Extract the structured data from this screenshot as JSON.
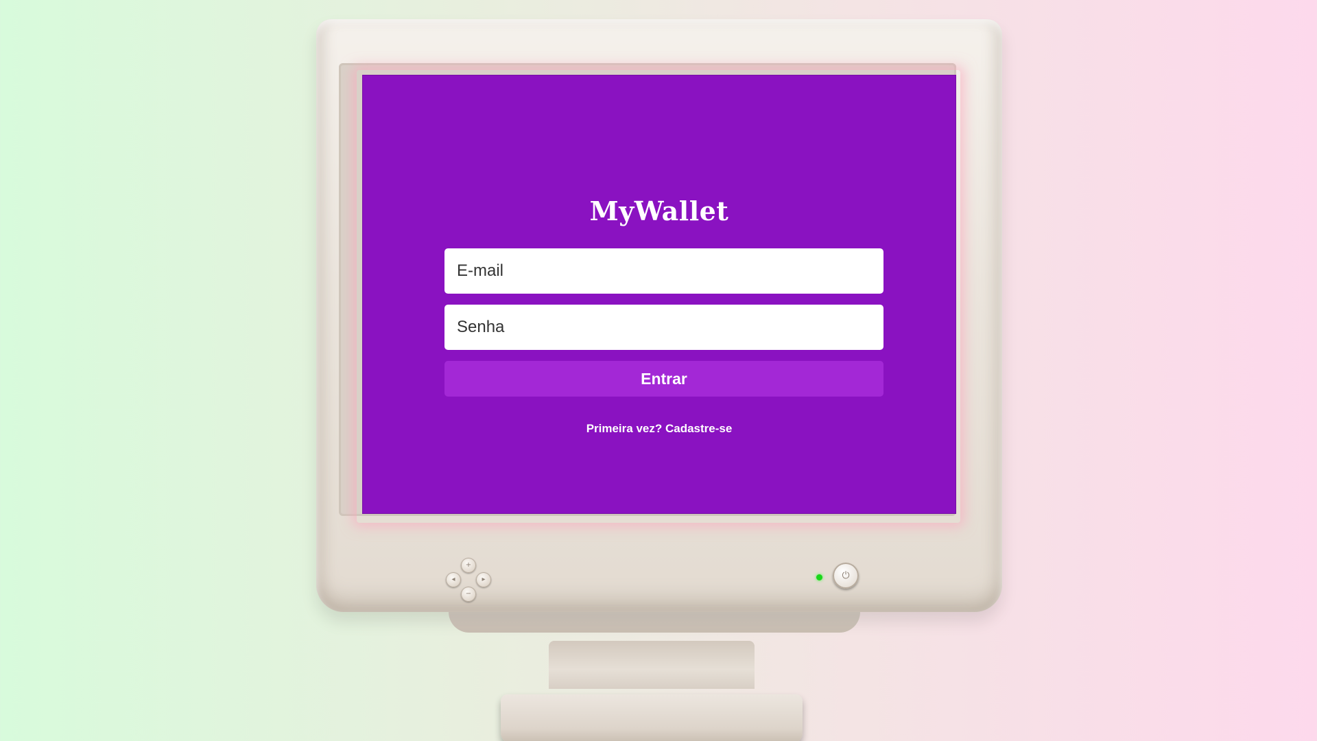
{
  "app": {
    "brand": "MyWallet"
  },
  "login_form": {
    "email_placeholder": "E-mail",
    "password_placeholder": "Senha",
    "submit_label": "Entrar",
    "signup_link": "Primeira vez? Cadastre-se"
  },
  "colors": {
    "screen_background": "#8a12c1",
    "button_background": "#a328d6",
    "text_light": "#ffffff",
    "power_led": "#1bd61b"
  },
  "icons": {
    "power": "power-icon",
    "dpad_up": "plus-icon",
    "dpad_down": "minus-icon",
    "dpad_left": "arrow-left-icon",
    "dpad_right": "arrow-right-icon"
  }
}
